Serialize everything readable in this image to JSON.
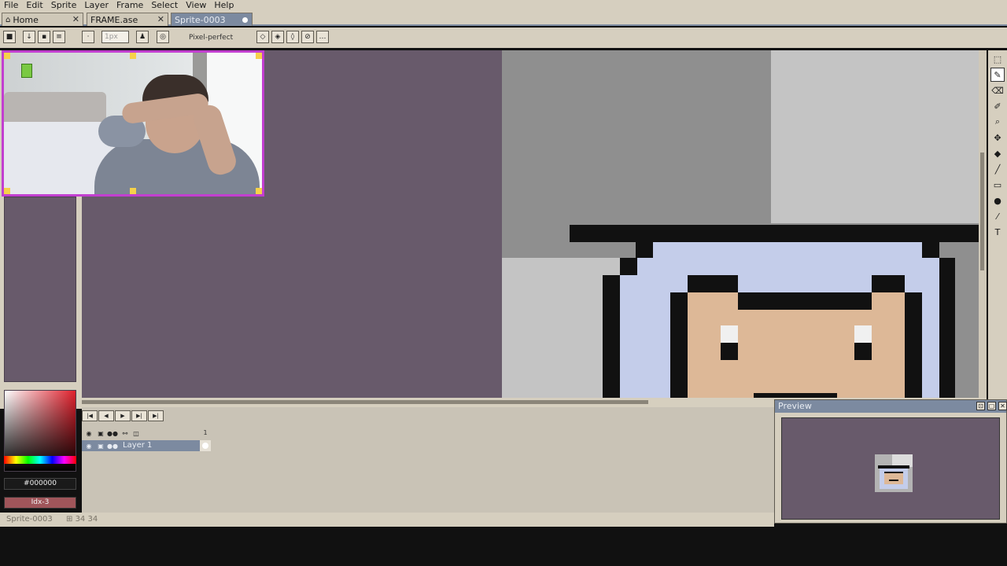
{
  "menu": [
    "File",
    "Edit",
    "Sprite",
    "Layer",
    "Frame",
    "Select",
    "View",
    "Help"
  ],
  "tabs": [
    {
      "label": "Home",
      "close": "✕"
    },
    {
      "label": "FRAME.ase",
      "close": "✕"
    },
    {
      "label": "Sprite-0003",
      "active": true
    }
  ],
  "toolbar": {
    "zoom_placeholder": "1px",
    "pixel_perfect_label": "Pixel-perfect"
  },
  "colors": {
    "canvas_bg": "#685a6b",
    "accent": "#7c8aa0",
    "webcam_border": "#c23fd0"
  },
  "color_panel": {
    "hex": "#000000",
    "index": "Idx-3"
  },
  "timeline": {
    "layer_name": "Layer 1",
    "frame_number": "1"
  },
  "preview": {
    "title": "Preview"
  },
  "status": {
    "sprite_name": "Sprite-0003",
    "coords": "34  34"
  },
  "tools": [
    "marquee-icon",
    "pencil-icon",
    "eraser-icon",
    "eyedropper-icon",
    "zoom-icon",
    "move-icon",
    "bucket-icon",
    "line-icon",
    "rectangle-icon",
    "blur-icon",
    "spray-icon",
    "text-icon"
  ]
}
